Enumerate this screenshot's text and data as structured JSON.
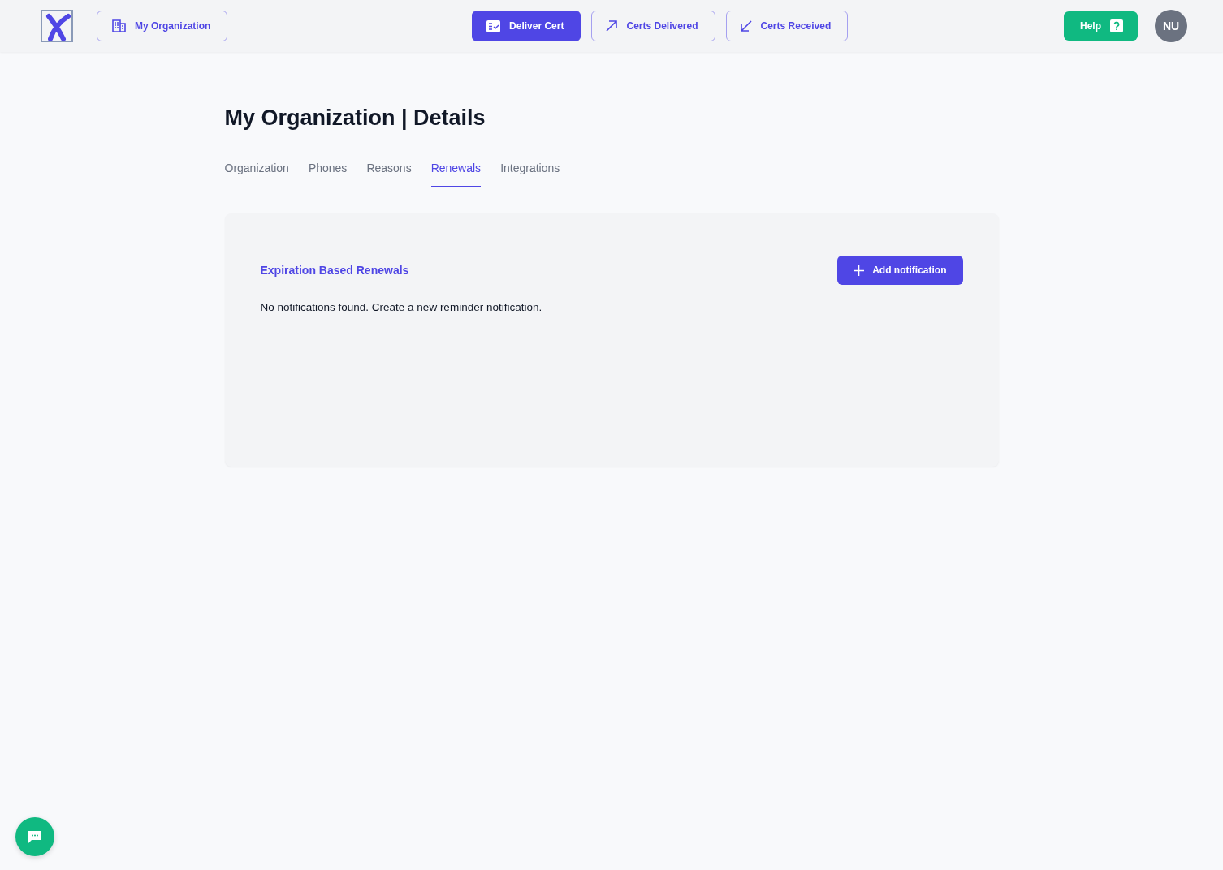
{
  "header": {
    "org_button": {
      "label": "My Organization"
    },
    "nav": [
      {
        "label": "Deliver Cert",
        "kind": "deliver",
        "selected": true
      },
      {
        "label": "Certs Delivered",
        "kind": "outgoing",
        "selected": false
      },
      {
        "label": "Certs Received",
        "kind": "incoming",
        "selected": false
      }
    ],
    "help_button": {
      "label": "Help"
    },
    "avatar": {
      "initials": "NU"
    }
  },
  "page_title": "My Organization | Details",
  "tabs": [
    {
      "label": "Organization",
      "selected": false
    },
    {
      "label": "Phones",
      "selected": false
    },
    {
      "label": "Reasons",
      "selected": false
    },
    {
      "label": "Renewals",
      "selected": true
    },
    {
      "label": "Integrations",
      "selected": false
    }
  ],
  "panel": {
    "title": "Expiration Based Renewals",
    "button": "Add notification",
    "message": "No notifications found. Create a new reminder notification."
  }
}
